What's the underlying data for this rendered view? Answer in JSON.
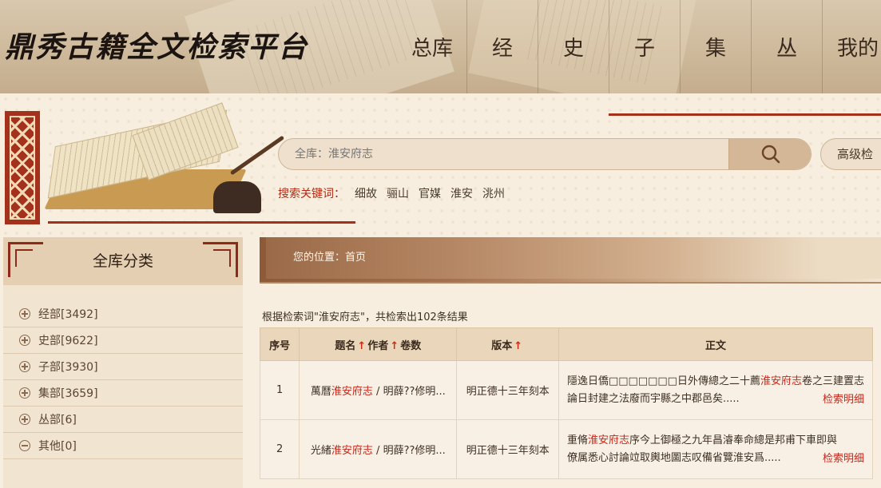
{
  "header": {
    "logo": "鼎秀古籍全文检索平台",
    "nav": [
      "总库",
      "经",
      "史",
      "子",
      "集",
      "丛",
      "我的"
    ]
  },
  "search": {
    "placeholder": "全库：淮安府志",
    "advanced_label": "高级检",
    "keywords_label": "搜索关键词：",
    "keywords": [
      "细故",
      "骊山",
      "官媒",
      "淮安",
      "洮州"
    ]
  },
  "sidebar": {
    "title": "全库分类",
    "items": [
      {
        "label": "经部[3492]",
        "state": "plus"
      },
      {
        "label": "史部[9622]",
        "state": "plus"
      },
      {
        "label": "子部[3930]",
        "state": "plus"
      },
      {
        "label": "集部[3659]",
        "state": "plus"
      },
      {
        "label": "丛部[6]",
        "state": "plus"
      },
      {
        "label": "其他[0]",
        "state": "minus"
      }
    ]
  },
  "breadcrumb": "您的位置：首页",
  "summary": "根据检索词\"淮安府志\"，共检索出102条结果",
  "table": {
    "headers": {
      "index": "序号",
      "title": "题名",
      "author": "作者",
      "volumes": "卷数",
      "edition": "版本",
      "text": "正文"
    },
    "detail_label": "检索明细",
    "rows": [
      {
        "index": "1",
        "title_pre": "萬曆",
        "title_hl": "淮安府志",
        "title_post": " / 明薛??修明...",
        "edition": "明正德十三年刻本",
        "line1_pre": "隱逸日僑□□□□□□□日外傳總之二十薦",
        "line1_hl": "淮安府志",
        "line1_post": "卷之三建置志",
        "line2": "論日封建之法廢而宇縣之中郡邑矣....."
      },
      {
        "index": "2",
        "title_pre": "光緒",
        "title_hl": "淮安府志",
        "title_post": " / 明薛??修明...",
        "edition": "明正德十三年刻本",
        "line1_pre": "重脩",
        "line1_hl": "淮安府志",
        "line1_post": "序今上御極之九年昌濬奉命總是邦甫下車即與",
        "line2": "僚属悉心討論竝取輿地圖志叹備省覽淮安爲....."
      }
    ]
  },
  "colors": {
    "accent_red": "#c8261a",
    "frame_red": "#a4311c",
    "background": "#f7eedf"
  }
}
